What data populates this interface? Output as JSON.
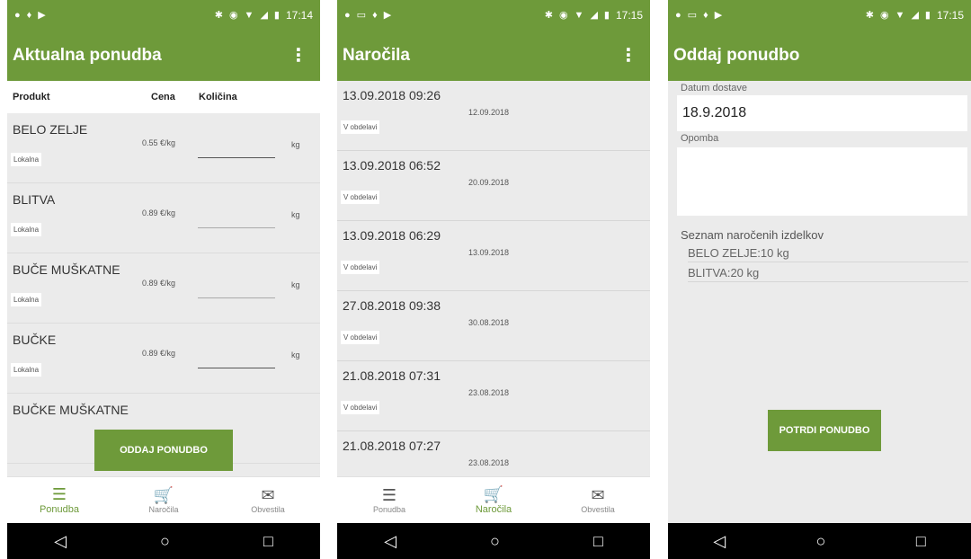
{
  "screens": [
    {
      "status": {
        "time": "17:14"
      },
      "title": "Aktualna ponudba",
      "table_headers": {
        "product": "Produkt",
        "price": "Cena",
        "qty": "Količina"
      },
      "products": [
        {
          "name": "BELO ZELJE",
          "tag": "Lokalna",
          "price": "0.55 €/kg",
          "unit": "kg"
        },
        {
          "name": "BLITVA",
          "tag": "Lokalna",
          "price": "0.89 €/kg",
          "unit": "kg"
        },
        {
          "name": "BUČE MUŠKATNE",
          "tag": "Lokalna",
          "price": "0.89 €/kg",
          "unit": "kg"
        },
        {
          "name": "BUČKE",
          "tag": "Lokalna",
          "price": "0.89 €/kg",
          "unit": "kg"
        },
        {
          "name": "BUČKE MUŠKATNE",
          "tag": "",
          "price": "",
          "unit": ""
        }
      ],
      "action_button": "ODDAJ PONUDBO",
      "nav": [
        {
          "label": "Ponudba"
        },
        {
          "label": "Naročila"
        },
        {
          "label": "Obvestila"
        }
      ]
    },
    {
      "status": {
        "time": "17:15"
      },
      "title": "Naročila",
      "orders": [
        {
          "created": "13.09.2018 09:26",
          "delivery": "12.09.2018",
          "status": "V obdelavi"
        },
        {
          "created": "13.09.2018 06:52",
          "delivery": "20.09.2018",
          "status": "V obdelavi"
        },
        {
          "created": "13.09.2018 06:29",
          "delivery": "13.09.2018",
          "status": "V obdelavi"
        },
        {
          "created": "27.08.2018 09:38",
          "delivery": "30.08.2018",
          "status": "V obdelavi"
        },
        {
          "created": "21.08.2018 07:31",
          "delivery": "23.08.2018",
          "status": "V obdelavi"
        },
        {
          "created": "21.08.2018 07:27",
          "delivery": "23.08.2018",
          "status": ""
        }
      ],
      "nav": [
        {
          "label": "Ponudba"
        },
        {
          "label": "Naročila"
        },
        {
          "label": "Obvestila"
        }
      ]
    },
    {
      "status": {
        "time": "17:15"
      },
      "title": "Oddaj ponudbo",
      "date_label": "Datum dostave",
      "date_value": "18.9.2018",
      "note_label": "Opomba",
      "note_value": "",
      "list_title": "Seznam naročenih izdelkov",
      "list_items": [
        "BELO ZELJE:10 kg",
        "BLITVA:20 kg"
      ],
      "confirm_button": "POTRDI PONUDBO"
    }
  ],
  "colors": {
    "brand": "#6e9a3a"
  },
  "icons": {
    "status_left": [
      "location-icon",
      "image-icon",
      "location-icon",
      "play-store-icon"
    ],
    "status_right": [
      "bluetooth-icon",
      "vibrate-icon",
      "wifi-icon",
      "signal-icon",
      "battery-icon"
    ],
    "nav": [
      "list-icon",
      "cart-icon",
      "mail-icon"
    ],
    "system": [
      "back-icon",
      "home-icon",
      "recents-icon"
    ]
  }
}
